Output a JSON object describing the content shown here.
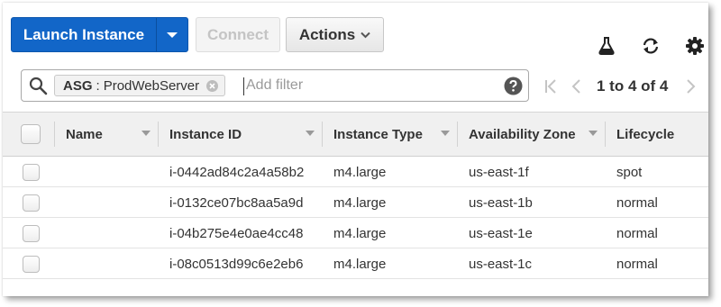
{
  "toolbar": {
    "launch_label": "Launch Instance",
    "connect_label": "Connect",
    "actions_label": "Actions",
    "icons": [
      "flask-icon",
      "refresh-icon",
      "gear-icon"
    ]
  },
  "filter": {
    "token_key": "ASG",
    "token_op": ":",
    "token_value": "ProdWebServer",
    "placeholder": "Add filter"
  },
  "pagination": {
    "text": "1 to 4 of 4"
  },
  "table": {
    "columns": [
      "Name",
      "Instance ID",
      "Instance Type",
      "Availability Zone",
      "Lifecycle"
    ],
    "rows": [
      {
        "name": "",
        "instance_id": "i-0442ad84c2a4a58b2",
        "instance_type": "m4.large",
        "zone": "us-east-1f",
        "lifecycle": "spot"
      },
      {
        "name": "",
        "instance_id": "i-0132ce07bc8aa5a9d",
        "instance_type": "m4.large",
        "zone": "us-east-1b",
        "lifecycle": "normal"
      },
      {
        "name": "",
        "instance_id": "i-04b275e4e0ae4cc48",
        "instance_type": "m4.large",
        "zone": "us-east-1e",
        "lifecycle": "normal"
      },
      {
        "name": "",
        "instance_id": "i-08c0513d99c6e2eb6",
        "instance_type": "m4.large",
        "zone": "us-east-1c",
        "lifecycle": "normal"
      }
    ]
  },
  "colors": {
    "primary": "#1266c8",
    "header_bg": "#f0f0f0",
    "text": "#333333"
  }
}
